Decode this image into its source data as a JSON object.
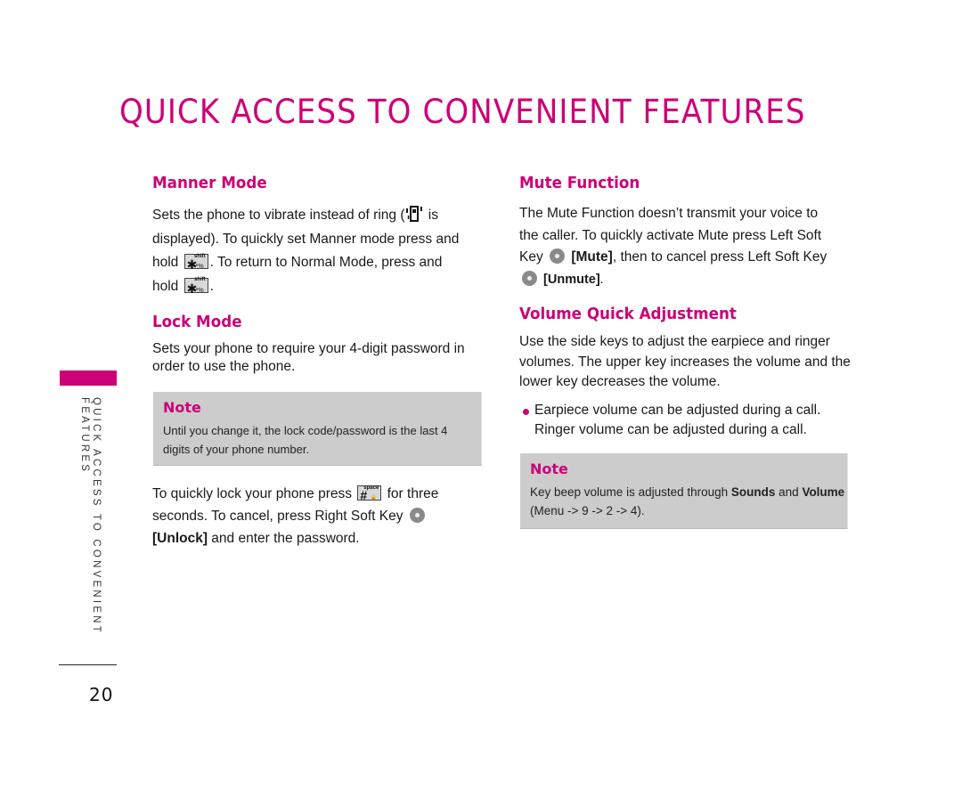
{
  "page": {
    "title": "QUICK ACCESS TO CONVENIENT FEATURES",
    "side_label_line1": "QUICK ACCESS TO CONVENIENT",
    "side_label_line2": "FEATURES",
    "page_number": "20",
    "accent_color": "#cc0077",
    "note_bg_color": "#cccccc"
  },
  "manner_mode": {
    "heading": "Manner Mode",
    "line1_a": "Sets the phone to vibrate instead of ring (",
    "line1_b": " is",
    "line2": "displayed). To quickly set Manner mode press and",
    "line3_a": "hold ",
    "line3_b": ". To return to Normal Mode, press and",
    "line4_a": "hold ",
    "line4_b": ".",
    "vibrate_icon": "vibrate-icon",
    "key": {
      "main": "✱",
      "sup": "*%",
      "sub": "shift",
      "icon": "star-shift-key-icon"
    }
  },
  "lock_mode": {
    "heading": "Lock Mode",
    "line1": "Sets your phone to require your 4-digit password in",
    "line2": "order to use the phone.",
    "note": {
      "title": "Note",
      "line1": "Until you change it, the lock code/password is the last 4",
      "line2": "digits of your phone number."
    },
    "p2_line1_a": "To quickly lock your phone press ",
    "p2_line1_b": " for three",
    "p2_line2": "seconds. To cancel, press Right Soft Key ",
    "p2_line3_bold": "[Unlock]",
    "p2_line3_rest": " and enter the password.",
    "key": {
      "main": "#",
      "sup": "🔒",
      "sub": "space",
      "icon": "pound-space-key-icon"
    },
    "softkey_icon": "right-soft-key-icon"
  },
  "mute_function": {
    "heading": "Mute Function",
    "line1": "The Mute Function doesn’t transmit your voice to",
    "line2": "the caller. To quickly activate Mute press Left Soft",
    "line3_a": "Key ",
    "line3_bold": "[Mute]",
    "line3_b": ", then to cancel press Left Soft Key",
    "line4_bold": "[Unmute]",
    "line4_b": ".",
    "softkey_icon": "left-soft-key-icon"
  },
  "volume_adjustment": {
    "heading": "Volume Quick Adjustment",
    "line1": "Use the side keys to adjust the earpiece and ringer",
    "line2": "volumes. The upper key increases the volume and the",
    "line3": "lower key decreases the volume.",
    "bullet_line1": "Earpiece volume can be adjusted during a call.",
    "bullet_line2": "Ringer volume can be adjusted during a call.",
    "note": {
      "title": "Note",
      "line1_a": "Key beep volume is adjusted through ",
      "line1_bold1": "Sounds",
      "line1_mid": " and ",
      "line1_bold2": "Volume",
      "line2": "(Menu -> 9 -> 2 -> 4)."
    }
  }
}
